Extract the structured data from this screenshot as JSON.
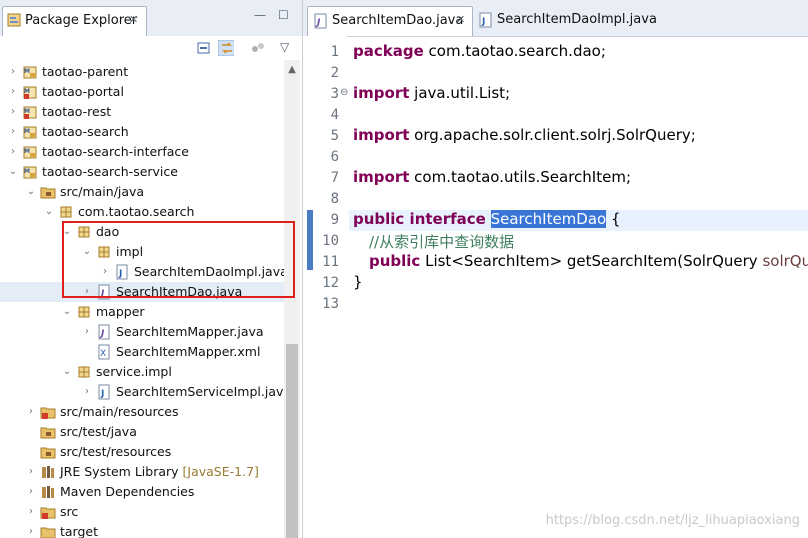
{
  "explorer": {
    "tab_label": "Package Explorer",
    "close_glyph": "✕",
    "minimize_glyph": "—",
    "maximize_glyph": "☐",
    "toolbar": {
      "icons": [
        "collapse-all-icon",
        "link-with-editor-icon",
        "focus-icon",
        "view-menu-icon"
      ],
      "view_menu_glyph": "▽"
    },
    "tree": [
      {
        "label": "taotao-parent",
        "arrow": "›",
        "icon": "maven-project-icon"
      },
      {
        "label": "taotao-portal",
        "arrow": "›",
        "icon": "web-project-icon"
      },
      {
        "label": "taotao-rest",
        "arrow": "›",
        "icon": "web-project-icon"
      },
      {
        "label": "taotao-search",
        "arrow": "›",
        "icon": "maven-project-icon"
      },
      {
        "label": "taotao-search-interface",
        "arrow": "›",
        "icon": "maven-project-icon"
      },
      {
        "label": "taotao-search-service",
        "arrow": "⌄",
        "icon": "maven-project-icon"
      },
      {
        "label": "src/main/java",
        "arrow": "⌄",
        "icon": "source-folder-icon"
      },
      {
        "label": "com.taotao.search",
        "arrow": "⌄",
        "icon": "package-icon"
      },
      {
        "label": "dao",
        "arrow": "⌄",
        "icon": "package-icon"
      },
      {
        "label": "impl",
        "arrow": "⌄",
        "icon": "package-icon"
      },
      {
        "label": "SearchItemDaoImpl.java",
        "arrow": "›",
        "icon": "java-file-icon"
      },
      {
        "label": "SearchItemDao.java",
        "arrow": "›",
        "icon": "java-interface-file-icon"
      },
      {
        "label": "mapper",
        "arrow": "⌄",
        "icon": "package-icon"
      },
      {
        "label": "SearchItemMapper.java",
        "arrow": "›",
        "icon": "java-interface-file-icon"
      },
      {
        "label": "SearchItemMapper.xml",
        "arrow": "",
        "icon": "xml-file-icon"
      },
      {
        "label": "service.impl",
        "arrow": "⌄",
        "icon": "package-icon"
      },
      {
        "label": "SearchItemServiceImpl.java",
        "arrow": "›",
        "icon": "java-file-icon"
      },
      {
        "label": "src/main/resources",
        "arrow": "›",
        "icon": "source-folder-error-icon"
      },
      {
        "label": "src/test/java",
        "arrow": "",
        "icon": "source-folder-icon"
      },
      {
        "label": "src/test/resources",
        "arrow": "",
        "icon": "source-folder-icon"
      },
      {
        "label": "JRE System Library",
        "decor": "[JavaSE-1.7]",
        "arrow": "›",
        "icon": "library-icon"
      },
      {
        "label": "Maven Dependencies",
        "arrow": "›",
        "icon": "library-icon"
      },
      {
        "label": "src",
        "arrow": "›",
        "icon": "folder-error-icon"
      },
      {
        "label": "target",
        "arrow": "›",
        "icon": "folder-icon"
      }
    ],
    "selected_item": "SearchItemDao.java"
  },
  "editor": {
    "tabs": [
      {
        "label": "SearchItemDao.java",
        "active": true,
        "close": "✕"
      },
      {
        "label": "SearchItemDaoImpl.java",
        "active": false
      }
    ],
    "line_numbers": [
      "1",
      "2",
      "3",
      "4",
      "5",
      "6",
      "7",
      "8",
      "9",
      "10",
      "11",
      "12",
      "13"
    ],
    "fold_glyph": "⊖",
    "code": {
      "l1_kw": "package",
      "l1_rest": " com.taotao.search.dao;",
      "l3_kw": "import",
      "l3_rest": " java.util.List;",
      "l5_kw": "import",
      "l5_rest": " org.apache.solr.client.solrj.SolrQuery;",
      "l7_kw": "import",
      "l7_rest": " com.taotao.utils.SearchItem;",
      "l9_kw": "public interface",
      "l9_sel": "SearchItemDao",
      "l9_rest": " {",
      "l10_comment": "//从索引库中查询数据",
      "l11_kw": "public",
      "l11_mid": " List<SearchItem> getSearchItem(SolrQuery ",
      "l11_param": "solrQuery",
      "l11_end": ");",
      "l12": "}"
    }
  },
  "watermark": "https://blog.csdn.net/ljz_lihuapiaoxiang",
  "colors": {
    "keyword": "#7f0055",
    "comment": "#3f7f5f",
    "selection": "#3875d7",
    "highlight_box": "#e0201c"
  }
}
